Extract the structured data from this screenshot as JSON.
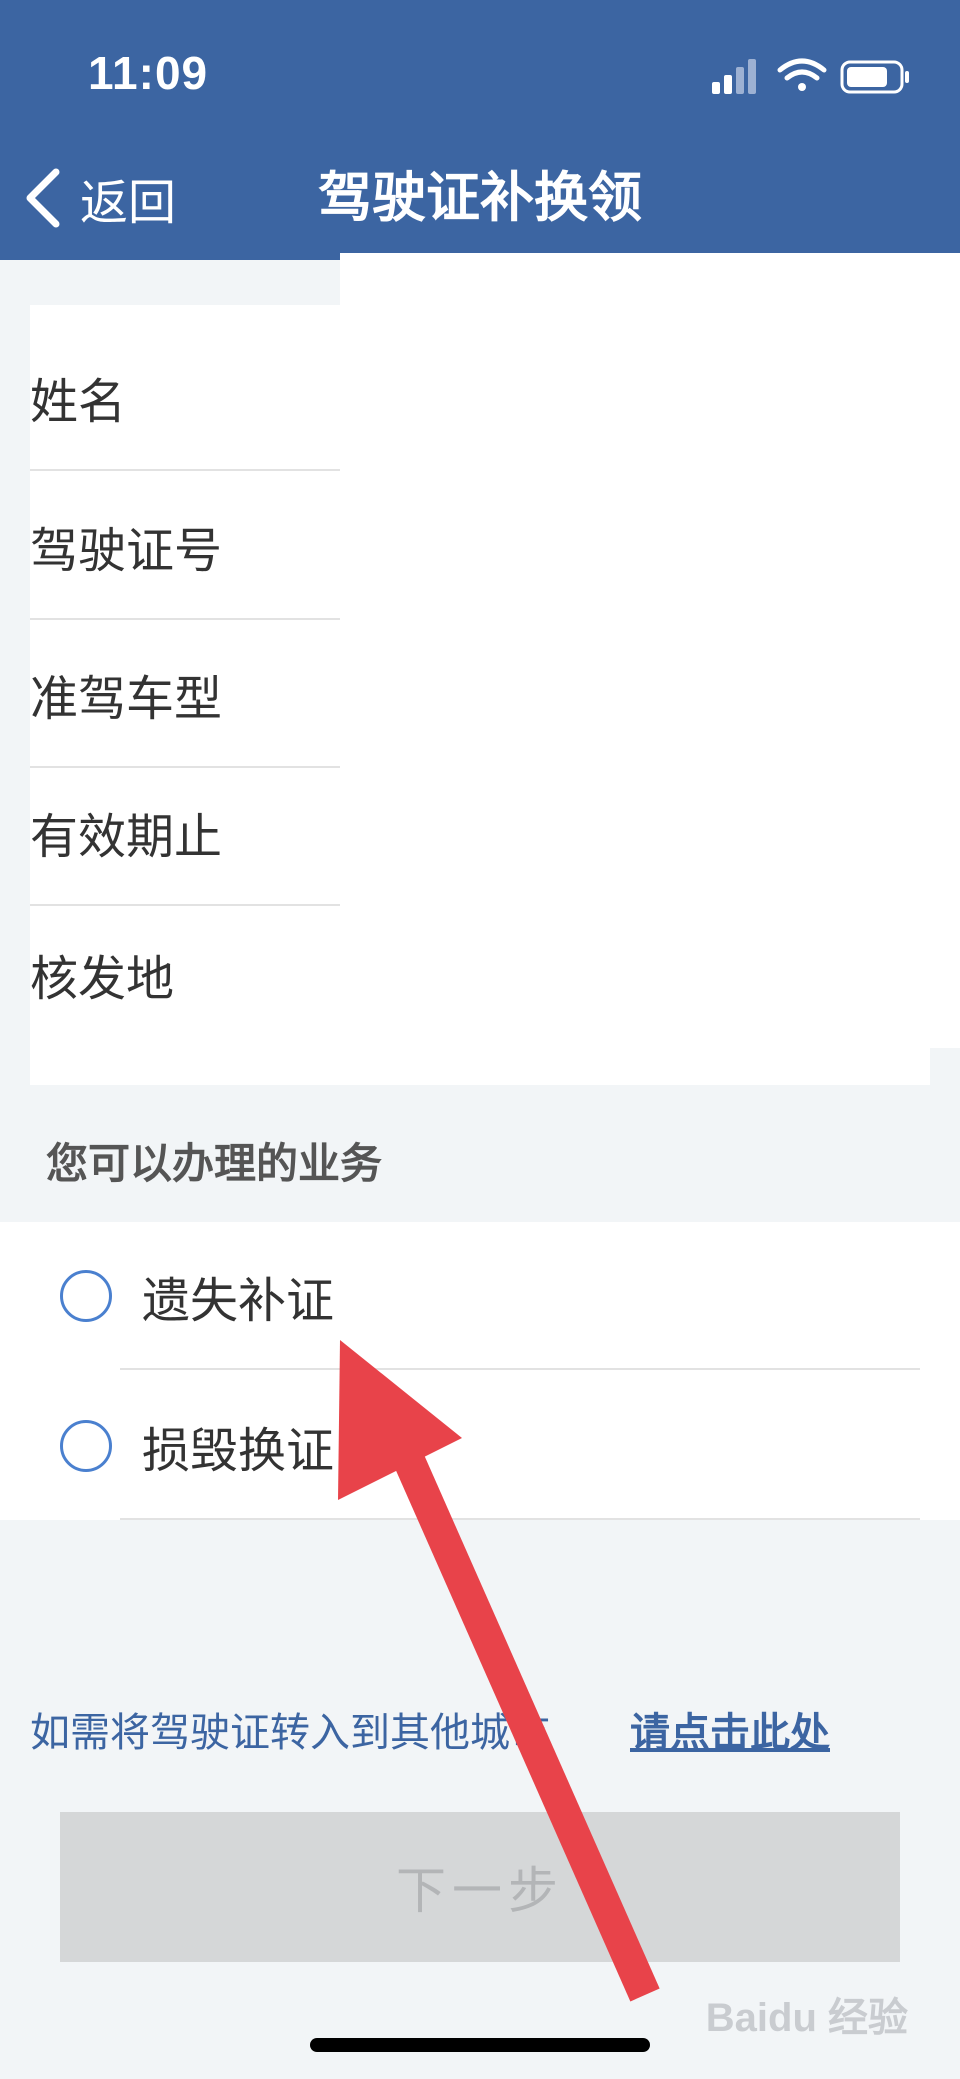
{
  "status_bar": {
    "time": "11:09"
  },
  "nav": {
    "back_label": "返回",
    "title": "驾驶证补换领"
  },
  "info_fields": [
    "姓名",
    "驾驶证号",
    "准驾车型",
    "有效期止",
    "核发地"
  ],
  "section_title": "您可以办理的业务",
  "options": [
    {
      "label": "遗失补证",
      "selected": false
    },
    {
      "label": "损毁换证",
      "selected": false
    }
  ],
  "transfer": {
    "text": "如需将驾驶证转入到其他城市",
    "link": "请点击此处"
  },
  "next_button": {
    "label": "下一步",
    "enabled": false
  },
  "watermark": "Baidu 经验",
  "colors": {
    "header": "#3c65a2",
    "accent": "#4a80cf",
    "annotation_arrow": "#e8434a"
  }
}
